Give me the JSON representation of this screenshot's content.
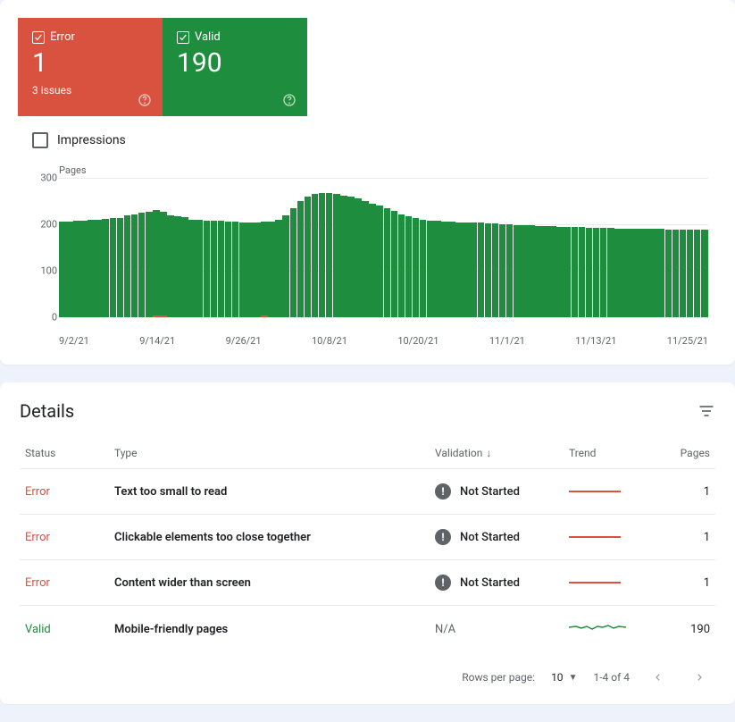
{
  "status_cards": {
    "error": {
      "label": "Error",
      "value": "1",
      "subline": "3 issues"
    },
    "valid": {
      "label": "Valid",
      "value": "190"
    }
  },
  "impressions_label": "Impressions",
  "chart_data": {
    "type": "bar",
    "title": "Pages",
    "ylabel": "Pages",
    "ylim": [
      0,
      300
    ],
    "y_ticks": [
      "0",
      "100",
      "200",
      "300"
    ],
    "x_ticks": [
      "9/2/21",
      "9/14/21",
      "9/26/21",
      "10/8/21",
      "10/20/21",
      "11/1/21",
      "11/13/21",
      "11/25/21"
    ],
    "series": [
      {
        "name": "Valid",
        "color": "#1e8e3e",
        "values": [
          205,
          205,
          207,
          208,
          210,
          210,
          212,
          213,
          214,
          220,
          222,
          225,
          227,
          228,
          223,
          220,
          218,
          216,
          210,
          210,
          208,
          208,
          207,
          205,
          205,
          204,
          204,
          203,
          203,
          205,
          210,
          220,
          235,
          250,
          260,
          265,
          268,
          268,
          265,
          262,
          260,
          256,
          250,
          245,
          240,
          235,
          228,
          222,
          218,
          214,
          210,
          208,
          207,
          206,
          205,
          204,
          204,
          203,
          203,
          202,
          201,
          200,
          200,
          199,
          198,
          198,
          197,
          196,
          196,
          195,
          195,
          194,
          194,
          193,
          193,
          192,
          192,
          191,
          191,
          190,
          190,
          190,
          190,
          190,
          189,
          189,
          189,
          189,
          188,
          188
        ]
      },
      {
        "name": "Error",
        "color": "#d9523f",
        "values": [
          0,
          0,
          0,
          0,
          0,
          0,
          0,
          0,
          0,
          0,
          0,
          0,
          0,
          1,
          1,
          0,
          0,
          0,
          0,
          0,
          0,
          0,
          0,
          0,
          0,
          0,
          0,
          0,
          1,
          0,
          0,
          0,
          0,
          0,
          0,
          0,
          0,
          0,
          0,
          0,
          0,
          0,
          0,
          0,
          0,
          0,
          0,
          0,
          0,
          0,
          0,
          0,
          0,
          0,
          0,
          0,
          0,
          0,
          0,
          0,
          0,
          0,
          0,
          0,
          0,
          0,
          0,
          0,
          0,
          0,
          0,
          0,
          0,
          0,
          0,
          0,
          0,
          0,
          0,
          0,
          0,
          0,
          0,
          0,
          0,
          0,
          0,
          0,
          0,
          0
        ]
      }
    ]
  },
  "details": {
    "title": "Details",
    "columns": {
      "status": "Status",
      "type": "Type",
      "validation": "Validation",
      "trend": "Trend",
      "pages": "Pages"
    },
    "rows": [
      {
        "status": "Error",
        "status_class": "error",
        "type": "Text too small to read",
        "validation": "Not Started",
        "val_icon": true,
        "trend": "flat-error",
        "pages": "1"
      },
      {
        "status": "Error",
        "status_class": "error",
        "type": "Clickable elements too close together",
        "validation": "Not Started",
        "val_icon": true,
        "trend": "flat-error",
        "pages": "1"
      },
      {
        "status": "Error",
        "status_class": "error",
        "type": "Content wider than screen",
        "validation": "Not Started",
        "val_icon": true,
        "trend": "flat-error",
        "pages": "1"
      },
      {
        "status": "Valid",
        "status_class": "valid",
        "type": "Mobile-friendly pages",
        "validation": "N/A",
        "val_icon": false,
        "trend": "spark",
        "pages": "190"
      }
    ]
  },
  "pager": {
    "rows_label": "Rows per page:",
    "rows_value": "10",
    "range": "1-4 of 4"
  }
}
